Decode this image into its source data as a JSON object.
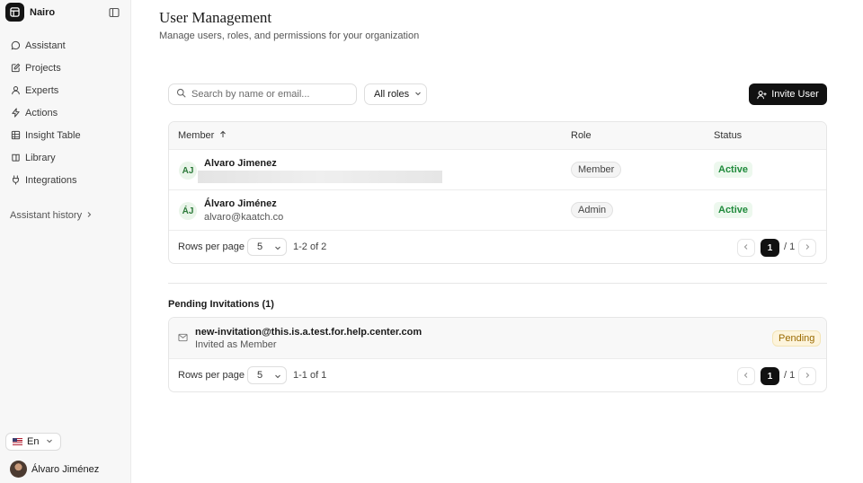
{
  "app": {
    "name": "Nairo"
  },
  "sidebar": {
    "items": [
      {
        "label": "Assistant",
        "icon": "chat-bubble-icon"
      },
      {
        "label": "Projects",
        "icon": "edit-square-icon"
      },
      {
        "label": "Experts",
        "icon": "user-icon"
      },
      {
        "label": "Actions",
        "icon": "zap-icon"
      },
      {
        "label": "Insight Table",
        "icon": "table-icon"
      },
      {
        "label": "Library",
        "icon": "book-icon"
      },
      {
        "label": "Integrations",
        "icon": "plug-icon"
      }
    ],
    "history_label": "Assistant history",
    "language": "En",
    "user_name": "Álvaro Jiménez"
  },
  "page": {
    "title": "User Management",
    "subtitle": "Manage users, roles, and permissions for your organization"
  },
  "toolbar": {
    "search_placeholder": "Search by name or email...",
    "role_filter": "All roles",
    "invite_label": "Invite User"
  },
  "members": {
    "columns": {
      "member": "Member",
      "role": "Role",
      "status": "Status"
    },
    "rows": [
      {
        "initials": "AJ",
        "name": "Alvaro Jimenez",
        "email": "",
        "role": "Member",
        "status": "Active"
      },
      {
        "initials": "ÁJ",
        "name": "Álvaro Jiménez",
        "email": "alvaro@kaatch.co",
        "role": "Admin",
        "status": "Active"
      }
    ],
    "pager": {
      "rows_label": "Rows per page",
      "rows_value": "5",
      "range": "1-2 of 2",
      "page": "1",
      "total": "/ 1"
    }
  },
  "pending": {
    "title": "Pending Invitations (1)",
    "rows": [
      {
        "email": "new-invitation@this.is.a.test.for.help.center.com",
        "role_text": "Invited as Member",
        "status": "Pending"
      }
    ],
    "pager": {
      "rows_label": "Rows per page",
      "rows_value": "5",
      "range": "1-1 of 1",
      "page": "1",
      "total": "/ 1"
    }
  },
  "colors": {
    "primary": "#111111",
    "active": "#1f8a3b",
    "pending": "#9a6a00",
    "sidebar_bg": "#f7f7f7"
  }
}
